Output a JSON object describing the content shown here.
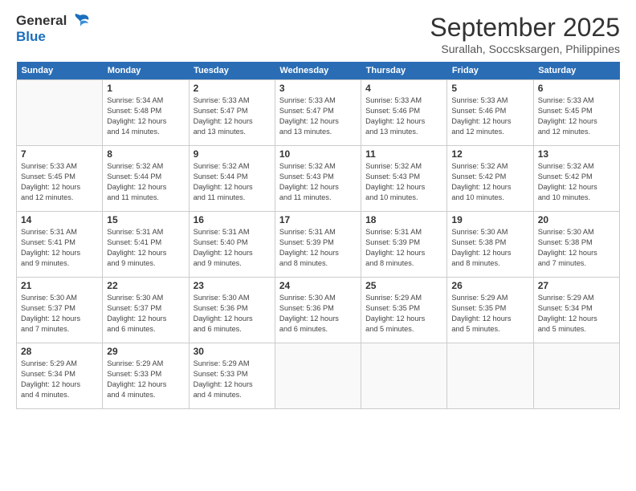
{
  "header": {
    "logo_line1": "General",
    "logo_line2": "Blue",
    "month": "September 2025",
    "location": "Surallah, Soccsksargen, Philippines"
  },
  "days_of_week": [
    "Sunday",
    "Monday",
    "Tuesday",
    "Wednesday",
    "Thursday",
    "Friday",
    "Saturday"
  ],
  "weeks": [
    [
      {
        "day": "",
        "info": ""
      },
      {
        "day": "1",
        "info": "Sunrise: 5:34 AM\nSunset: 5:48 PM\nDaylight: 12 hours\nand 14 minutes."
      },
      {
        "day": "2",
        "info": "Sunrise: 5:33 AM\nSunset: 5:47 PM\nDaylight: 12 hours\nand 13 minutes."
      },
      {
        "day": "3",
        "info": "Sunrise: 5:33 AM\nSunset: 5:47 PM\nDaylight: 12 hours\nand 13 minutes."
      },
      {
        "day": "4",
        "info": "Sunrise: 5:33 AM\nSunset: 5:46 PM\nDaylight: 12 hours\nand 13 minutes."
      },
      {
        "day": "5",
        "info": "Sunrise: 5:33 AM\nSunset: 5:46 PM\nDaylight: 12 hours\nand 12 minutes."
      },
      {
        "day": "6",
        "info": "Sunrise: 5:33 AM\nSunset: 5:45 PM\nDaylight: 12 hours\nand 12 minutes."
      }
    ],
    [
      {
        "day": "7",
        "info": "Sunrise: 5:33 AM\nSunset: 5:45 PM\nDaylight: 12 hours\nand 12 minutes."
      },
      {
        "day": "8",
        "info": "Sunrise: 5:32 AM\nSunset: 5:44 PM\nDaylight: 12 hours\nand 11 minutes."
      },
      {
        "day": "9",
        "info": "Sunrise: 5:32 AM\nSunset: 5:44 PM\nDaylight: 12 hours\nand 11 minutes."
      },
      {
        "day": "10",
        "info": "Sunrise: 5:32 AM\nSunset: 5:43 PM\nDaylight: 12 hours\nand 11 minutes."
      },
      {
        "day": "11",
        "info": "Sunrise: 5:32 AM\nSunset: 5:43 PM\nDaylight: 12 hours\nand 10 minutes."
      },
      {
        "day": "12",
        "info": "Sunrise: 5:32 AM\nSunset: 5:42 PM\nDaylight: 12 hours\nand 10 minutes."
      },
      {
        "day": "13",
        "info": "Sunrise: 5:32 AM\nSunset: 5:42 PM\nDaylight: 12 hours\nand 10 minutes."
      }
    ],
    [
      {
        "day": "14",
        "info": "Sunrise: 5:31 AM\nSunset: 5:41 PM\nDaylight: 12 hours\nand 9 minutes."
      },
      {
        "day": "15",
        "info": "Sunrise: 5:31 AM\nSunset: 5:41 PM\nDaylight: 12 hours\nand 9 minutes."
      },
      {
        "day": "16",
        "info": "Sunrise: 5:31 AM\nSunset: 5:40 PM\nDaylight: 12 hours\nand 9 minutes."
      },
      {
        "day": "17",
        "info": "Sunrise: 5:31 AM\nSunset: 5:39 PM\nDaylight: 12 hours\nand 8 minutes."
      },
      {
        "day": "18",
        "info": "Sunrise: 5:31 AM\nSunset: 5:39 PM\nDaylight: 12 hours\nand 8 minutes."
      },
      {
        "day": "19",
        "info": "Sunrise: 5:30 AM\nSunset: 5:38 PM\nDaylight: 12 hours\nand 8 minutes."
      },
      {
        "day": "20",
        "info": "Sunrise: 5:30 AM\nSunset: 5:38 PM\nDaylight: 12 hours\nand 7 minutes."
      }
    ],
    [
      {
        "day": "21",
        "info": "Sunrise: 5:30 AM\nSunset: 5:37 PM\nDaylight: 12 hours\nand 7 minutes."
      },
      {
        "day": "22",
        "info": "Sunrise: 5:30 AM\nSunset: 5:37 PM\nDaylight: 12 hours\nand 6 minutes."
      },
      {
        "day": "23",
        "info": "Sunrise: 5:30 AM\nSunset: 5:36 PM\nDaylight: 12 hours\nand 6 minutes."
      },
      {
        "day": "24",
        "info": "Sunrise: 5:30 AM\nSunset: 5:36 PM\nDaylight: 12 hours\nand 6 minutes."
      },
      {
        "day": "25",
        "info": "Sunrise: 5:29 AM\nSunset: 5:35 PM\nDaylight: 12 hours\nand 5 minutes."
      },
      {
        "day": "26",
        "info": "Sunrise: 5:29 AM\nSunset: 5:35 PM\nDaylight: 12 hours\nand 5 minutes."
      },
      {
        "day": "27",
        "info": "Sunrise: 5:29 AM\nSunset: 5:34 PM\nDaylight: 12 hours\nand 5 minutes."
      }
    ],
    [
      {
        "day": "28",
        "info": "Sunrise: 5:29 AM\nSunset: 5:34 PM\nDaylight: 12 hours\nand 4 minutes."
      },
      {
        "day": "29",
        "info": "Sunrise: 5:29 AM\nSunset: 5:33 PM\nDaylight: 12 hours\nand 4 minutes."
      },
      {
        "day": "30",
        "info": "Sunrise: 5:29 AM\nSunset: 5:33 PM\nDaylight: 12 hours\nand 4 minutes."
      },
      {
        "day": "",
        "info": ""
      },
      {
        "day": "",
        "info": ""
      },
      {
        "day": "",
        "info": ""
      },
      {
        "day": "",
        "info": ""
      }
    ]
  ]
}
